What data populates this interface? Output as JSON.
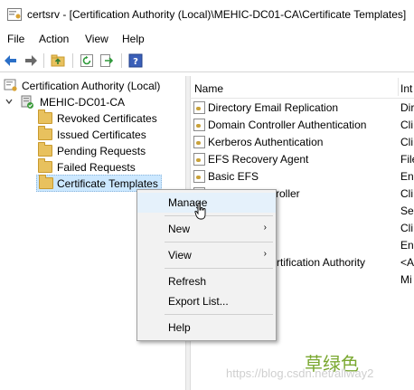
{
  "window": {
    "title": "certsrv - [Certification Authority (Local)\\MEHIC-DC01-CA\\Certificate Templates]"
  },
  "menu": {
    "file": "File",
    "action": "Action",
    "view": "View",
    "help": "Help"
  },
  "toolbar": {
    "icons": [
      "back-arrow-icon",
      "forward-arrow-icon",
      "up-folder-icon",
      "refresh-icon",
      "export-icon",
      "help-icon"
    ]
  },
  "tree": {
    "root": "Certification Authority (Local)",
    "ca": "MEHIC-DC01-CA",
    "folders": [
      "Revoked Certificates",
      "Issued Certificates",
      "Pending Requests",
      "Failed Requests",
      "Certificate Templates"
    ]
  },
  "list": {
    "col_name": "Name",
    "col_intended": "Int",
    "rows": [
      {
        "name": "Directory Email Replication",
        "intended": "Dir"
      },
      {
        "name": "Domain Controller Authentication",
        "intended": "Cli"
      },
      {
        "name": "Kerberos Authentication",
        "intended": "Cli"
      },
      {
        "name": "EFS Recovery Agent",
        "intended": "File"
      },
      {
        "name": "Basic EFS",
        "intended": "En"
      },
      {
        "name": "roller",
        "intended": "Cli"
      },
      {
        "name": "",
        "intended": "Ser"
      },
      {
        "name": "",
        "intended": "Cli"
      },
      {
        "name": "",
        "intended": "En"
      },
      {
        "name": "rtification Authority",
        "intended": "<A"
      },
      {
        "name": "",
        "intended": "Mi"
      }
    ]
  },
  "context_menu": {
    "manage": "Manage",
    "new": "New",
    "view": "View",
    "refresh": "Refresh",
    "export": "Export List...",
    "help": "Help",
    "submenu_arrow": "›"
  },
  "watermark": {
    "cn": "草绿色",
    "url": "https://blog.csdn.net/allway2"
  }
}
